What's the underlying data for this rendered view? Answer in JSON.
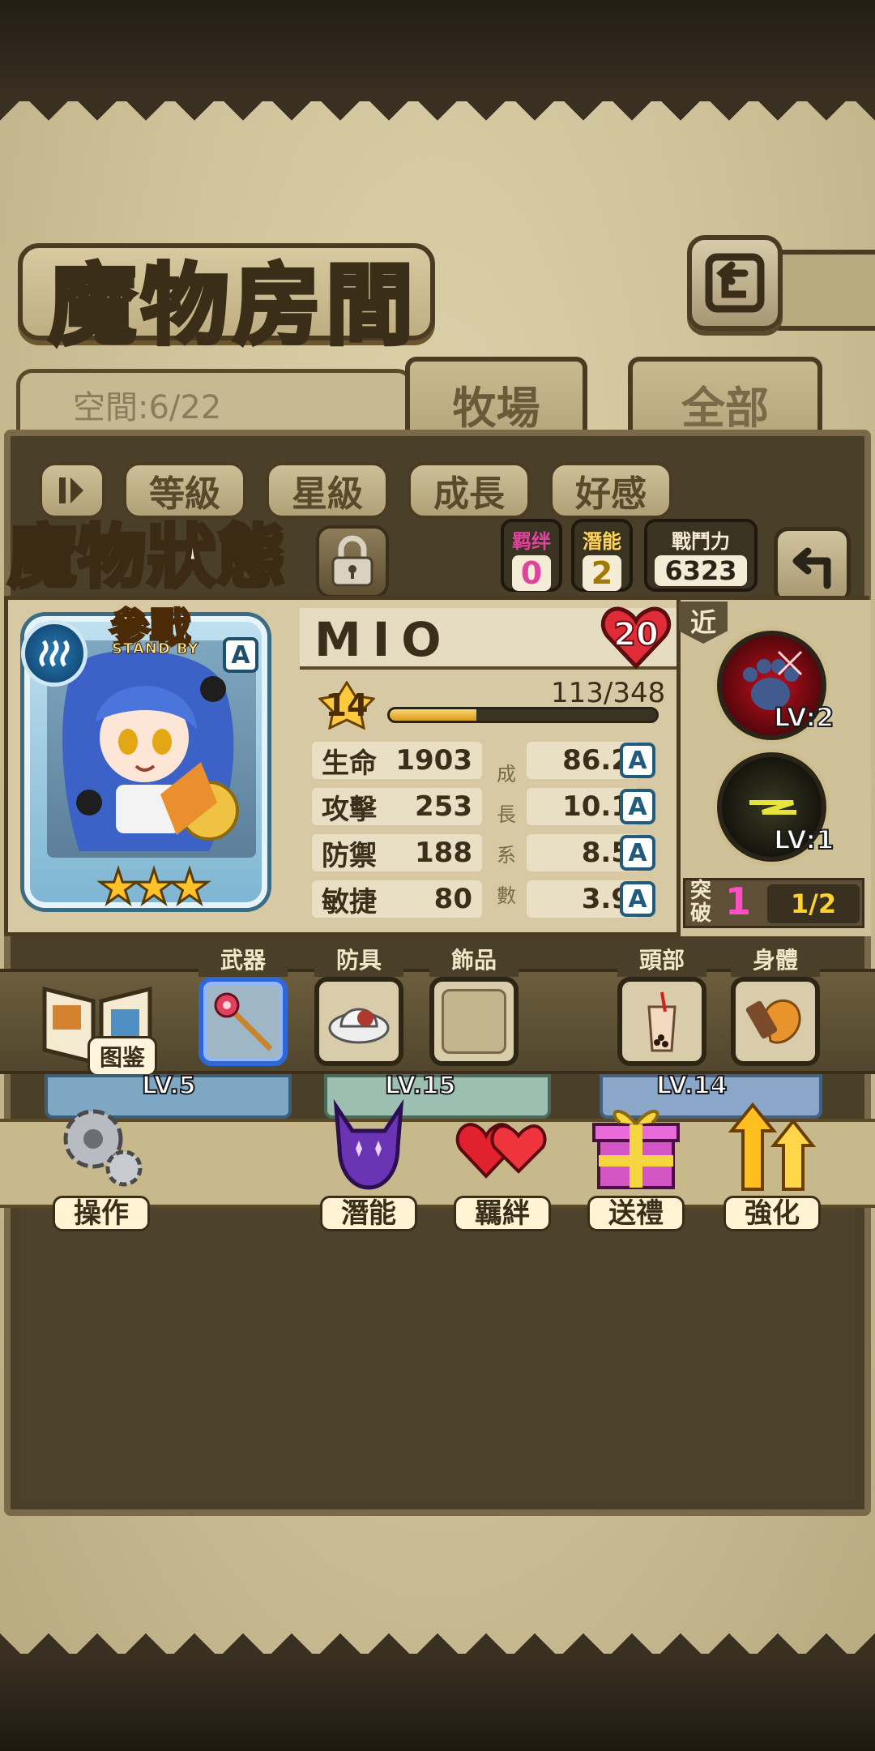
{
  "room": {
    "title": "魔物房間",
    "space_label": "空間:6/22",
    "tabs": [
      {
        "label": "牧場",
        "active": true
      },
      {
        "label": "全部",
        "active": false
      }
    ],
    "sort_buttons": [
      "等級",
      "星級",
      "成長",
      "好感"
    ]
  },
  "status": {
    "title": "魔物狀態",
    "mini_stats": [
      {
        "label": "羁绊",
        "value": "0",
        "color": "#e0439c"
      },
      {
        "label": "潛能",
        "value": "2",
        "color": "#a07a00"
      },
      {
        "label": "戰鬥力",
        "value": "6323",
        "color": "#2a2418"
      }
    ]
  },
  "monster": {
    "name": "MIO",
    "level": "20",
    "star_level": "14",
    "battle_label": "參戰",
    "standby_label": "STAND BY",
    "rarity": "A",
    "stars": 3,
    "exp_text": "113/348",
    "exp_fraction": 0.3247,
    "stats": [
      {
        "name": "生命",
        "value": "1903",
        "growth": "86.2",
        "grade": "A"
      },
      {
        "name": "攻擊",
        "value": "253",
        "growth": "10.1",
        "grade": "A"
      },
      {
        "name": "防禦",
        "value": "188",
        "growth": "8.5",
        "grade": "A"
      },
      {
        "name": "敏捷",
        "value": "80",
        "growth": "3.9",
        "grade": "A"
      }
    ],
    "growth_label": [
      "成",
      "長",
      "系",
      "數"
    ],
    "range": "近",
    "skills": [
      {
        "level": "LV:2",
        "icon": "paw-icon"
      },
      {
        "level": "LV:1",
        "icon": "lightning-icon"
      }
    ],
    "breakthrough_label": "突破",
    "breakthrough_count": "1",
    "breakthrough_progress": "1/2"
  },
  "equipment": {
    "codex_label": "图鉴",
    "slots": [
      {
        "label": "武器",
        "icon": "scepter-icon",
        "selected": true
      },
      {
        "label": "防具",
        "icon": "hat-icon",
        "selected": false
      },
      {
        "label": "飾品",
        "icon": "",
        "selected": false
      },
      {
        "label": "頭部",
        "icon": "bubble-tea-icon",
        "selected": false
      },
      {
        "label": "身體",
        "icon": "chicken-leg-icon",
        "selected": false
      }
    ]
  },
  "list_peek": [
    "LV.5",
    "LV.15",
    "LV.14"
  ],
  "actions": [
    {
      "label": "操作",
      "icon": "gear-icon"
    },
    {
      "label": "潛能",
      "icon": "demon-icon"
    },
    {
      "label": "羈絆",
      "icon": "hearts-icon"
    },
    {
      "label": "送禮",
      "icon": "gift-icon"
    },
    {
      "label": "強化",
      "icon": "upgrade-arrows-icon"
    }
  ]
}
